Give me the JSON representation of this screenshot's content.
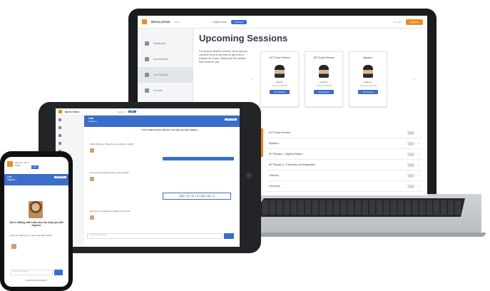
{
  "laptop": {
    "brand": "REVOLUTION",
    "brand_sub": "PREP",
    "nav_text": "Study Hours",
    "nav_button": "Schedule",
    "help_text": "Get Help",
    "cta": "Upgrade",
    "sidebar": [
      "Dashboard",
      "Assessments",
      "Live Tutoring",
      "Courses",
      "Practice"
    ],
    "title": "Upcoming Sessions",
    "description": "For all your classes & tutors, we've got you covered! Drop in any time to get help or prepare for a test. Please join the session that works for you.",
    "cards": [
      {
        "subject": "ACT Exam Review",
        "tutor": "Eva B.",
        "time": "Today at 1:00 PM",
        "button": "Join Session"
      },
      {
        "subject": "SAT Exam Review",
        "tutor": "Laura S.",
        "time": "Today at 2:00 PM",
        "button": "Join Session"
      },
      {
        "subject": "Algebra I",
        "tutor": "Robert J.",
        "time": "Tomorrow at 10 AM",
        "button": "Join Session"
      }
    ],
    "list": [
      "ACT Exam Review",
      "Algebra I",
      "AP Physics I - Algebra Based",
      "AP Physics II - Electricity and Magnetism",
      "Calculus",
      "Geometry"
    ]
  },
  "tablet": {
    "brand": "REVOLUTION",
    "header_sub": "Algebra I",
    "header_button": "Live",
    "chat_tutor": "Laila",
    "chat_subject": "Algebra I",
    "end_button": "End Chat",
    "intro": "You're talking with Laila who can help you with Algebra.",
    "messages": [
      "Hello! Welcome. What are you working on today?",
      "Let's work through this step by step together.",
      "Remember to isolate the variable on one side."
    ],
    "equation": "3x(2 + 4) + 2x = 8 + 4(3 + 2x) + 2",
    "input_placeholder": "Type your message..."
  },
  "phone": {
    "brand": "REVOLUTION",
    "brand_sub": "PREP",
    "chat_tutor": "Laila",
    "chat_subject": "Algebra I",
    "button": "Live",
    "end_button": "End Chat",
    "intro": "You're talking with Laila who can help you with Algebra.",
    "message": "Hi there! What do you need help with today?",
    "input_placeholder": "Type your message..."
  }
}
